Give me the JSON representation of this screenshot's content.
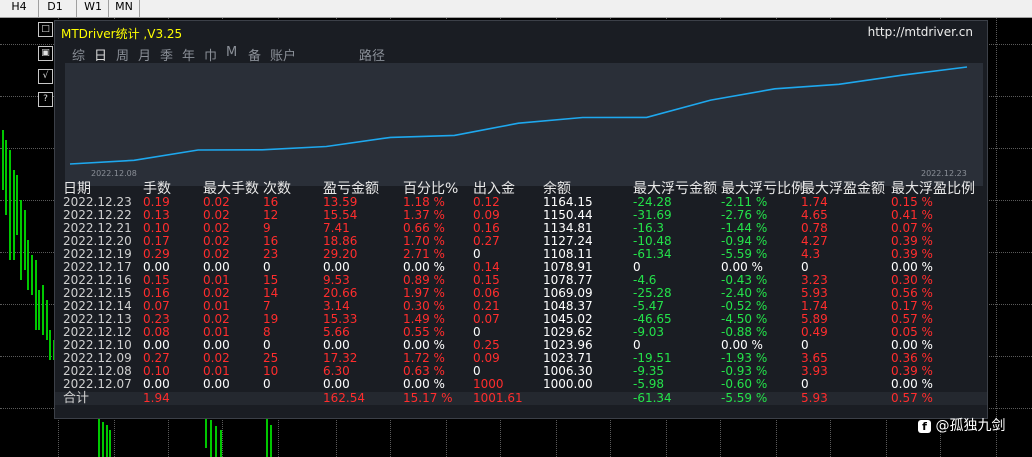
{
  "timeframes": [
    "H4",
    "D1",
    "W1",
    "MN"
  ],
  "side_icons": [
    "zoom-icon",
    "properties-icon",
    "indicator-icon",
    "help-icon"
  ],
  "side_icon_glyphs": [
    "□",
    "▣",
    "√",
    "?"
  ],
  "panel": {
    "title": "MTDriver统计 ,V3.25",
    "url": "http://mtdriver.cn",
    "tabs": [
      "综",
      "日",
      "周",
      "月",
      "季",
      "年",
      "巾",
      "M",
      "备",
      "账户",
      "路径"
    ],
    "active_tab": 1
  },
  "equity_chart": {
    "start_label": "2022.12.08",
    "end_label": "2022.12.23",
    "line_color": "#1ea8ee",
    "values": [
      1000.0,
      1006.3,
      1023.71,
      1023.96,
      1029.62,
      1045.02,
      1048.37,
      1069.09,
      1078.77,
      1078.91,
      1108.11,
      1127.24,
      1134.81,
      1150.44,
      1164.15
    ]
  },
  "table": {
    "headers": [
      "日期",
      "手数",
      "最大手数",
      "次数",
      "盈亏金额",
      "百分比%",
      "出入金",
      "余额",
      "最大浮亏金额",
      "最大浮亏比例",
      "最大浮盈金额",
      "最大浮盈比例"
    ],
    "rows": [
      {
        "date": "2022.12.23",
        "lots": "0.19",
        "maxlots": "0.02",
        "count": "16",
        "pnl": "13.59",
        "pct": "1.18 %",
        "io": "0.12",
        "bal": "1164.15",
        "mfl": "-24.28",
        "mflp": "-2.11 %",
        "mfp": "1.74",
        "mfpp": "0.15 %",
        "z": false
      },
      {
        "date": "2022.12.22",
        "lots": "0.13",
        "maxlots": "0.02",
        "count": "12",
        "pnl": "15.54",
        "pct": "1.37 %",
        "io": "0.09",
        "bal": "1150.44",
        "mfl": "-31.69",
        "mflp": "-2.76 %",
        "mfp": "4.65",
        "mfpp": "0.41 %",
        "z": false
      },
      {
        "date": "2022.12.21",
        "lots": "0.10",
        "maxlots": "0.02",
        "count": "9",
        "pnl": "7.41",
        "pct": "0.66 %",
        "io": "0.16",
        "bal": "1134.81",
        "mfl": "-16.3",
        "mflp": "-1.44 %",
        "mfp": "0.78",
        "mfpp": "0.07 %",
        "z": false
      },
      {
        "date": "2022.12.20",
        "lots": "0.17",
        "maxlots": "0.02",
        "count": "16",
        "pnl": "18.86",
        "pct": "1.70 %",
        "io": "0.27",
        "bal": "1127.24",
        "mfl": "-10.48",
        "mflp": "-0.94 %",
        "mfp": "4.27",
        "mfpp": "0.39 %",
        "z": false
      },
      {
        "date": "2022.12.19",
        "lots": "0.29",
        "maxlots": "0.02",
        "count": "23",
        "pnl": "29.20",
        "pct": "2.71 %",
        "io": "0",
        "bal": "1108.11",
        "mfl": "-61.34",
        "mflp": "-5.59 %",
        "mfp": "4.3",
        "mfpp": "0.39 %",
        "z": false
      },
      {
        "date": "2022.12.17",
        "lots": "0.00",
        "maxlots": "0.00",
        "count": "0",
        "pnl": "0.00",
        "pct": "0.00 %",
        "io": "0.14",
        "bal": "1078.91",
        "mfl": "0",
        "mflp": "0.00 %",
        "mfp": "0",
        "mfpp": "0.00 %",
        "z": true
      },
      {
        "date": "2022.12.16",
        "lots": "0.15",
        "maxlots": "0.01",
        "count": "15",
        "pnl": "9.53",
        "pct": "0.89 %",
        "io": "0.15",
        "bal": "1078.77",
        "mfl": "-4.6",
        "mflp": "-0.43 %",
        "mfp": "3.23",
        "mfpp": "0.30 %",
        "z": false
      },
      {
        "date": "2022.12.15",
        "lots": "0.16",
        "maxlots": "0.02",
        "count": "14",
        "pnl": "20.66",
        "pct": "1.97 %",
        "io": "0.06",
        "bal": "1069.09",
        "mfl": "-25.28",
        "mflp": "-2.40 %",
        "mfp": "5.93",
        "mfpp": "0.56 %",
        "z": false
      },
      {
        "date": "2022.12.14",
        "lots": "0.07",
        "maxlots": "0.01",
        "count": "7",
        "pnl": "3.14",
        "pct": "0.30 %",
        "io": "0.21",
        "bal": "1048.37",
        "mfl": "-5.47",
        "mflp": "-0.52 %",
        "mfp": "1.74",
        "mfpp": "0.17 %",
        "z": false
      },
      {
        "date": "2022.12.13",
        "lots": "0.23",
        "maxlots": "0.02",
        "count": "19",
        "pnl": "15.33",
        "pct": "1.49 %",
        "io": "0.07",
        "bal": "1045.02",
        "mfl": "-46.65",
        "mflp": "-4.50 %",
        "mfp": "5.89",
        "mfpp": "0.57 %",
        "z": false
      },
      {
        "date": "2022.12.12",
        "lots": "0.08",
        "maxlots": "0.01",
        "count": "8",
        "pnl": "5.66",
        "pct": "0.55 %",
        "io": "0",
        "bal": "1029.62",
        "mfl": "-9.03",
        "mflp": "-0.88 %",
        "mfp": "0.49",
        "mfpp": "0.05 %",
        "z": false
      },
      {
        "date": "2022.12.10",
        "lots": "0.00",
        "maxlots": "0.00",
        "count": "0",
        "pnl": "0.00",
        "pct": "0.00 %",
        "io": "0.25",
        "bal": "1023.96",
        "mfl": "0",
        "mflp": "0.00 %",
        "mfp": "0",
        "mfpp": "0.00 %",
        "z": true
      },
      {
        "date": "2022.12.09",
        "lots": "0.27",
        "maxlots": "0.02",
        "count": "25",
        "pnl": "17.32",
        "pct": "1.72 %",
        "io": "0.09",
        "bal": "1023.71",
        "mfl": "-19.51",
        "mflp": "-1.93 %",
        "mfp": "3.65",
        "mfpp": "0.36 %",
        "z": false
      },
      {
        "date": "2022.12.08",
        "lots": "0.10",
        "maxlots": "0.01",
        "count": "10",
        "pnl": "6.30",
        "pct": "0.63 %",
        "io": "0",
        "bal": "1006.30",
        "mfl": "-9.35",
        "mflp": "-0.93 %",
        "mfp": "3.93",
        "mfpp": "0.39 %",
        "z": false
      },
      {
        "date": "2022.12.07",
        "lots": "0.00",
        "maxlots": "0.00",
        "count": "0",
        "pnl": "0.00",
        "pct": "0.00 %",
        "io": "1000",
        "bal": "1000.00",
        "mfl": "-5.98",
        "mflp": "-0.60 %",
        "mfp": "0",
        "mfpp": "0.00 %",
        "z": true
      }
    ],
    "total": {
      "label": "合计",
      "lots": "1.94",
      "pnl": "162.54",
      "pct": "15.17 %",
      "io": "1001.61",
      "mfl": "-61.34",
      "mflp": "-5.59 %",
      "mfp": "5.93",
      "mfpp": "0.57 %"
    }
  },
  "watermark": {
    "icon": "f",
    "text": "@孤独九剑"
  }
}
